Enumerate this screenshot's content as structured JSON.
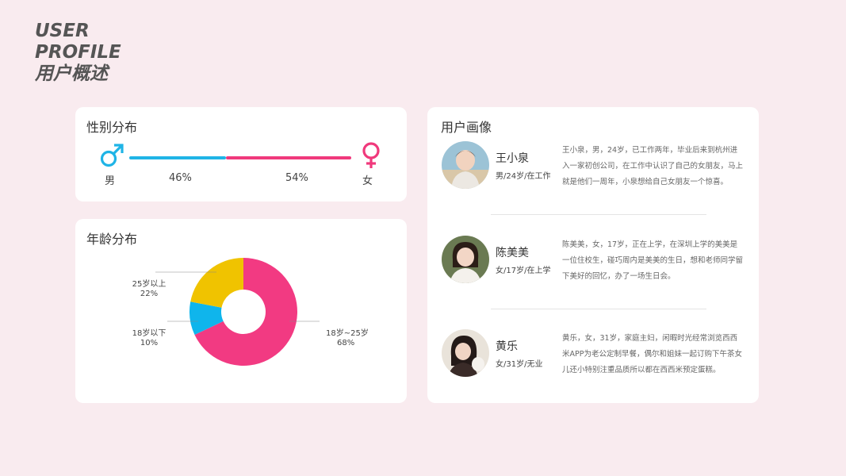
{
  "header": {
    "line1": "USER",
    "line2": "PROFILE",
    "line3": "用户概述"
  },
  "colors": {
    "male": "#1fb4e6",
    "female": "#f0397c",
    "age_young": "#0fb5ec",
    "age_mid": "#f23a82",
    "age_old": "#f0c300",
    "background": "#f9ebef"
  },
  "gender": {
    "title": "性别分布",
    "male_label": "男",
    "female_label": "女",
    "male_pct": "46%",
    "female_pct": "54%",
    "male_icon": "male-symbol-icon",
    "female_icon": "female-symbol-icon"
  },
  "age": {
    "title": "年龄分布"
  },
  "chart_data": {
    "type": "pie",
    "title": "年龄分布",
    "categories": [
      "18岁~25岁",
      "18岁以下",
      "25岁以上"
    ],
    "values": [
      68,
      10,
      22
    ],
    "labels": [
      {
        "name": "18岁~25岁",
        "pct": "68%"
      },
      {
        "name": "18岁以下",
        "pct": "10%"
      },
      {
        "name": "25岁以上",
        "pct": "22%"
      }
    ],
    "donut": true
  },
  "profile": {
    "title": "用户画像",
    "people": [
      {
        "name": "王小泉",
        "meta": "男/24岁/在工作",
        "desc": "王小泉，男，24岁，已工作两年，毕业后来到杭州进入一家初创公司，在工作中认识了自己的女朋友，马上就是他们一周年，小泉想给自己女朋友一个惊喜。"
      },
      {
        "name": "陈美美",
        "meta": "女/17岁/在上学",
        "desc": "陈美美，女，17岁，正在上学，在深圳上学的美美是一位住校生，碰巧周内是美美的生日，想和老师同学留下美好的回忆，办了一场生日会。"
      },
      {
        "name": "黄乐",
        "meta": "女/31岁/无业",
        "desc": "黄乐，女，31岁，家庭主妇，闲暇时光经常浏览西西米APP为老公定制早餐，偶尔和姐妹一起订购下午茶女儿还小特别注重品质所以都在西西米预定蛋糕。"
      }
    ]
  }
}
